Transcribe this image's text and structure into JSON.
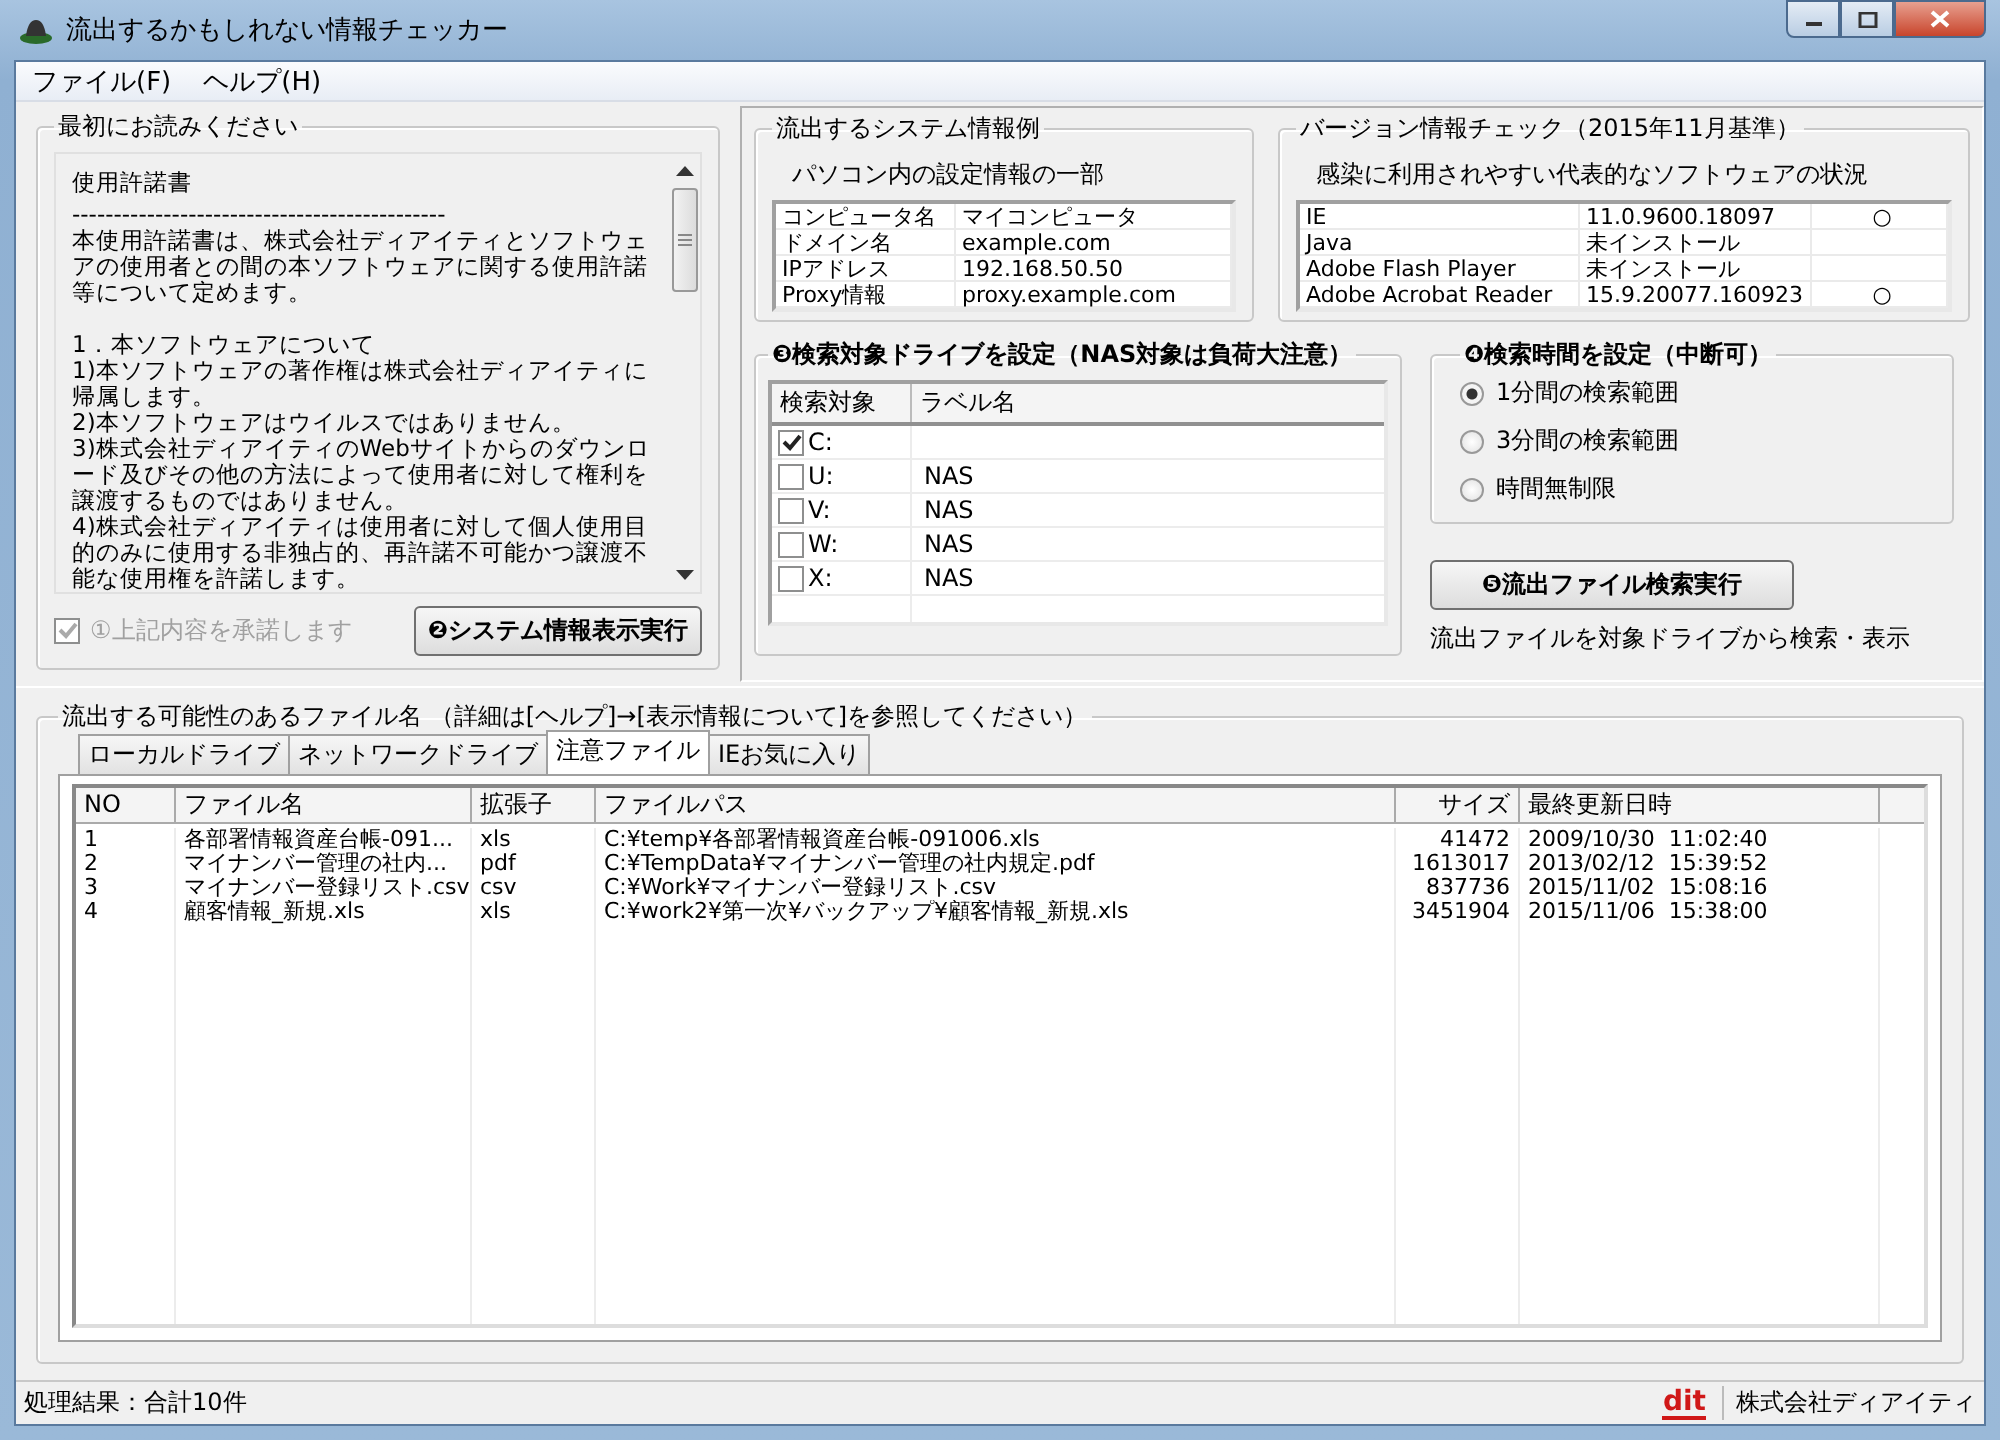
{
  "window": {
    "title": "流出するかもしれない情報チェッカー"
  },
  "menu": [
    "ファイル(F)",
    "ヘルプ(H)"
  ],
  "readme": {
    "title": "最初にお読みください",
    "paragraphs": [
      {
        "kind": "text",
        "text": "使用許諾書"
      },
      {
        "kind": "text",
        "text": "---------------------------------------------"
      },
      {
        "kind": "text",
        "text": "本使用許諾書は、株式会社ディアイティとソフトウェアの使用者との間の本ソフトウェアに関する使用許諾等について定めます。"
      },
      {
        "kind": "heading",
        "text": "1．本ソフトウェアについて"
      },
      {
        "kind": "text",
        "text": "1)本ソフトウェアの著作権は株式会社ディアイティに帰属します。"
      },
      {
        "kind": "text",
        "text": "2)本ソフトウェアはウイルスではありません。"
      },
      {
        "kind": "text",
        "text": "3)株式会社ディアイティのWebサイトからのダウンロード及びその他の方法によって使用者に対して権利を譲渡するものではありません。"
      },
      {
        "kind": "text",
        "text": "4)株式会社ディアイティは使用者に対して個人使用目的のみに使用する非独占的、再許諾不可能かつ譲渡不能な使用権を許諾します。"
      }
    ],
    "accept": {
      "label": "①上記内容を承諾します",
      "checked": true,
      "disabled": true
    },
    "run_button": "❷システム情報表示実行"
  },
  "system_info": {
    "title": "流出するシステム情報例",
    "subtitle": "パソコン内の設定情報の一部",
    "rows": [
      {
        "name": "コンピュータ名",
        "value": "マイコンピュータ"
      },
      {
        "name": "ドメイン名",
        "value": "example.com"
      },
      {
        "name": "IPアドレス",
        "value": "192.168.50.50"
      },
      {
        "name": "Proxy情報",
        "value": "proxy.example.com"
      }
    ]
  },
  "version_check": {
    "title": "バージョン情報チェック（2015年11月基準）",
    "subtitle": "感染に利用されやすい代表的なソフトウェアの状況",
    "rows": [
      {
        "name": "IE",
        "version": "11.0.9600.18097",
        "status": "○"
      },
      {
        "name": "Java",
        "version": "未インストール"
      },
      {
        "name": "Adobe Flash Player",
        "version": "未インストール"
      },
      {
        "name": "Adobe Acrobat Reader",
        "version": "15.9.20077.160923",
        "status": "○"
      }
    ]
  },
  "drives": {
    "title": "❸検索対象ドライブを設定（NAS対象は負荷大注意）",
    "columns": [
      "検索対象",
      "ラベル名"
    ],
    "rows": [
      {
        "drive": "C:",
        "checked": true
      },
      {
        "drive": "U:",
        "label": "NAS",
        "checked": false
      },
      {
        "drive": "V:",
        "label": "NAS",
        "checked": false
      },
      {
        "drive": "W:",
        "label": "NAS",
        "checked": false
      },
      {
        "drive": "X:",
        "label": "NAS",
        "checked": false
      }
    ]
  },
  "search_time": {
    "title": "❹検索時間を設定（中断可）",
    "options": [
      {
        "label": "1分間の検索範囲",
        "selected": true
      },
      {
        "label": "3分間の検索範囲",
        "selected": false
      },
      {
        "label": "時間無制限",
        "selected": false
      }
    ]
  },
  "search_button": {
    "label": "❺流出ファイル検索実行",
    "caption": "流出ファイルを対象ドライブから検索・表示"
  },
  "results": {
    "title": "流出する可能性のあるファイル名 （詳細は[ヘルプ]→[表示情報について]を参照してください）",
    "tabs": [
      {
        "label": "ローカルドライブ",
        "selected": false
      },
      {
        "label": "ネットワークドライブ",
        "selected": false
      },
      {
        "label": "注意ファイル",
        "selected": true
      },
      {
        "label": "IEお気に入り",
        "selected": false
      }
    ],
    "columns": [
      "NO",
      "ファイル名",
      "拡張子",
      "ファイルパス",
      "サイズ",
      "最終更新日時"
    ],
    "rows": [
      [
        "1",
        "各部署情報資産台帳-091...",
        "xls",
        "C:¥temp¥各部署情報資産台帳-091006.xls",
        "41472",
        "2009/10/30  11:02:40"
      ],
      [
        "2",
        "マイナンバー管理の社内...",
        "pdf",
        "C:¥TempData¥マイナンバー管理の社内規定.pdf",
        "1613017",
        "2013/02/12  15:39:52"
      ],
      [
        "3",
        "マイナンバー登録リスト.csv",
        "csv",
        "C:¥Work¥マイナンバー登録リスト.csv",
        "837736",
        "2015/11/02  15:08:16"
      ],
      [
        "4",
        "顧客情報_新規.xls",
        "xls",
        "C:¥work2¥第一次¥バックアップ¥顧客情報_新規.xls",
        "3451904",
        "2015/11/06  15:38:00"
      ]
    ]
  },
  "status_bar": {
    "text": "処理結果：合計10件",
    "logo": "dit",
    "company": "株式会社ディアイティ"
  }
}
